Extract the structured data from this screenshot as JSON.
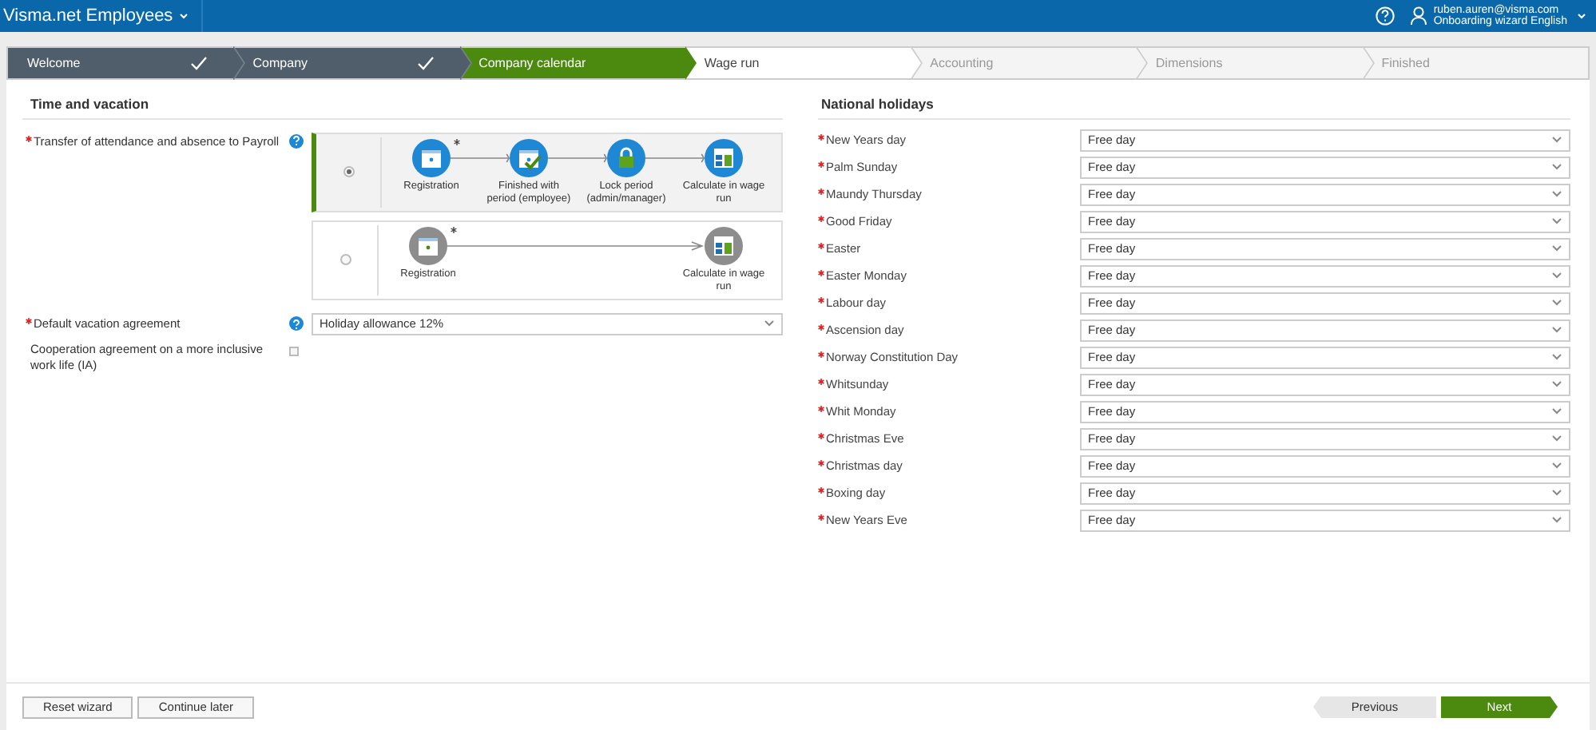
{
  "header": {
    "app_title": "Visma.net Employees",
    "user_email": "ruben.auren@visma.com",
    "user_context": "Onboarding wizard English"
  },
  "steps": [
    {
      "label": "Welcome",
      "kind": "done"
    },
    {
      "label": "Company",
      "kind": "done"
    },
    {
      "label": "Company calendar",
      "kind": "current"
    },
    {
      "label": "Wage run",
      "kind": "next"
    },
    {
      "label": "Accounting",
      "kind": "future"
    },
    {
      "label": "Dimensions",
      "kind": "future"
    },
    {
      "label": "Finished",
      "kind": "future"
    }
  ],
  "time_and_vacation": {
    "title": "Time and vacation",
    "transfer": {
      "label": "Transfer of attendance and absence to Payroll",
      "required": true,
      "options": [
        {
          "selected": true,
          "nodes": [
            {
              "label": "Registration",
              "kind": "calendar",
              "starred": true
            },
            {
              "label": "Finished with period (employee)",
              "kind": "calendar-check",
              "starred": false
            },
            {
              "label": "Lock period (admin/manager)",
              "kind": "lock",
              "starred": false
            },
            {
              "label": "Calculate in wage run",
              "kind": "calculator",
              "starred": false
            }
          ]
        },
        {
          "selected": false,
          "nodes": [
            {
              "label": "Registration",
              "kind": "calendar",
              "starred": true
            },
            {
              "label": "Calculate in wage run",
              "kind": "calculator",
              "starred": false
            }
          ]
        }
      ]
    },
    "vacation": {
      "label": "Default vacation agreement",
      "required": true,
      "value": "Holiday allowance 12%"
    },
    "cooperation": {
      "label": "Cooperation agreement on a more inclusive work life (IA)",
      "required": false,
      "checked": false
    }
  },
  "national_holidays": {
    "title": "National holidays",
    "rows": [
      {
        "label": "New Years day",
        "required": true,
        "value": "Free day"
      },
      {
        "label": "Palm Sunday",
        "required": true,
        "value": "Free day"
      },
      {
        "label": "Maundy Thursday",
        "required": true,
        "value": "Free day"
      },
      {
        "label": "Good Friday",
        "required": true,
        "value": "Free day"
      },
      {
        "label": "Easter",
        "required": true,
        "value": "Free day"
      },
      {
        "label": "Easter Monday",
        "required": true,
        "value": "Free day"
      },
      {
        "label": "Labour day",
        "required": true,
        "value": "Free day"
      },
      {
        "label": "Ascension day",
        "required": true,
        "value": "Free day"
      },
      {
        "label": "Norway Constitution Day",
        "required": true,
        "value": "Free day"
      },
      {
        "label": "Whitsunday",
        "required": true,
        "value": "Free day"
      },
      {
        "label": "Whit Monday",
        "required": true,
        "value": "Free day"
      },
      {
        "label": "Christmas Eve",
        "required": true,
        "value": "Free day"
      },
      {
        "label": "Christmas day",
        "required": true,
        "value": "Free day"
      },
      {
        "label": "Boxing day",
        "required": true,
        "value": "Free day"
      },
      {
        "label": "New Years Eve",
        "required": true,
        "value": "Free day"
      }
    ]
  },
  "footer": {
    "left_buttons": [
      "Reset wizard",
      "Continue later"
    ],
    "previous": "Previous",
    "next": "Next"
  }
}
